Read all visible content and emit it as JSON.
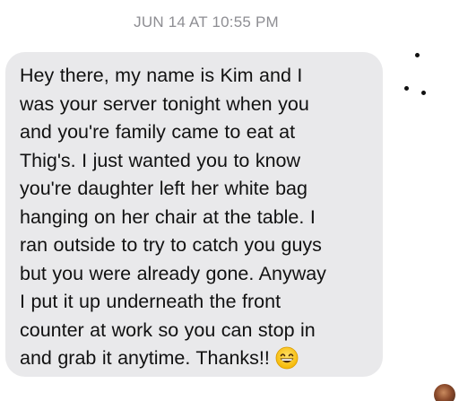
{
  "timestamp": "JUN 14 AT 10:55 PM",
  "message": {
    "text": "Hey there, my name is Kim and I\nwas your server tonight when you\nand you're family came to eat at\nThig's. I just wanted you to know\nyou're daughter left her white bag\nhanging on her chair at the table. I\nran outside to try to catch you guys\nbut you were already gone. Anyway\nI put it up underneath the front\ncounter at work so you can stop in\nand grab it anytime. Thanks!!",
    "emoji": "grinning-face-with-smiling-eyes"
  },
  "colors": {
    "bubble": "#e9e9eb",
    "timestamp": "#8e8e93",
    "text": "#111111"
  }
}
